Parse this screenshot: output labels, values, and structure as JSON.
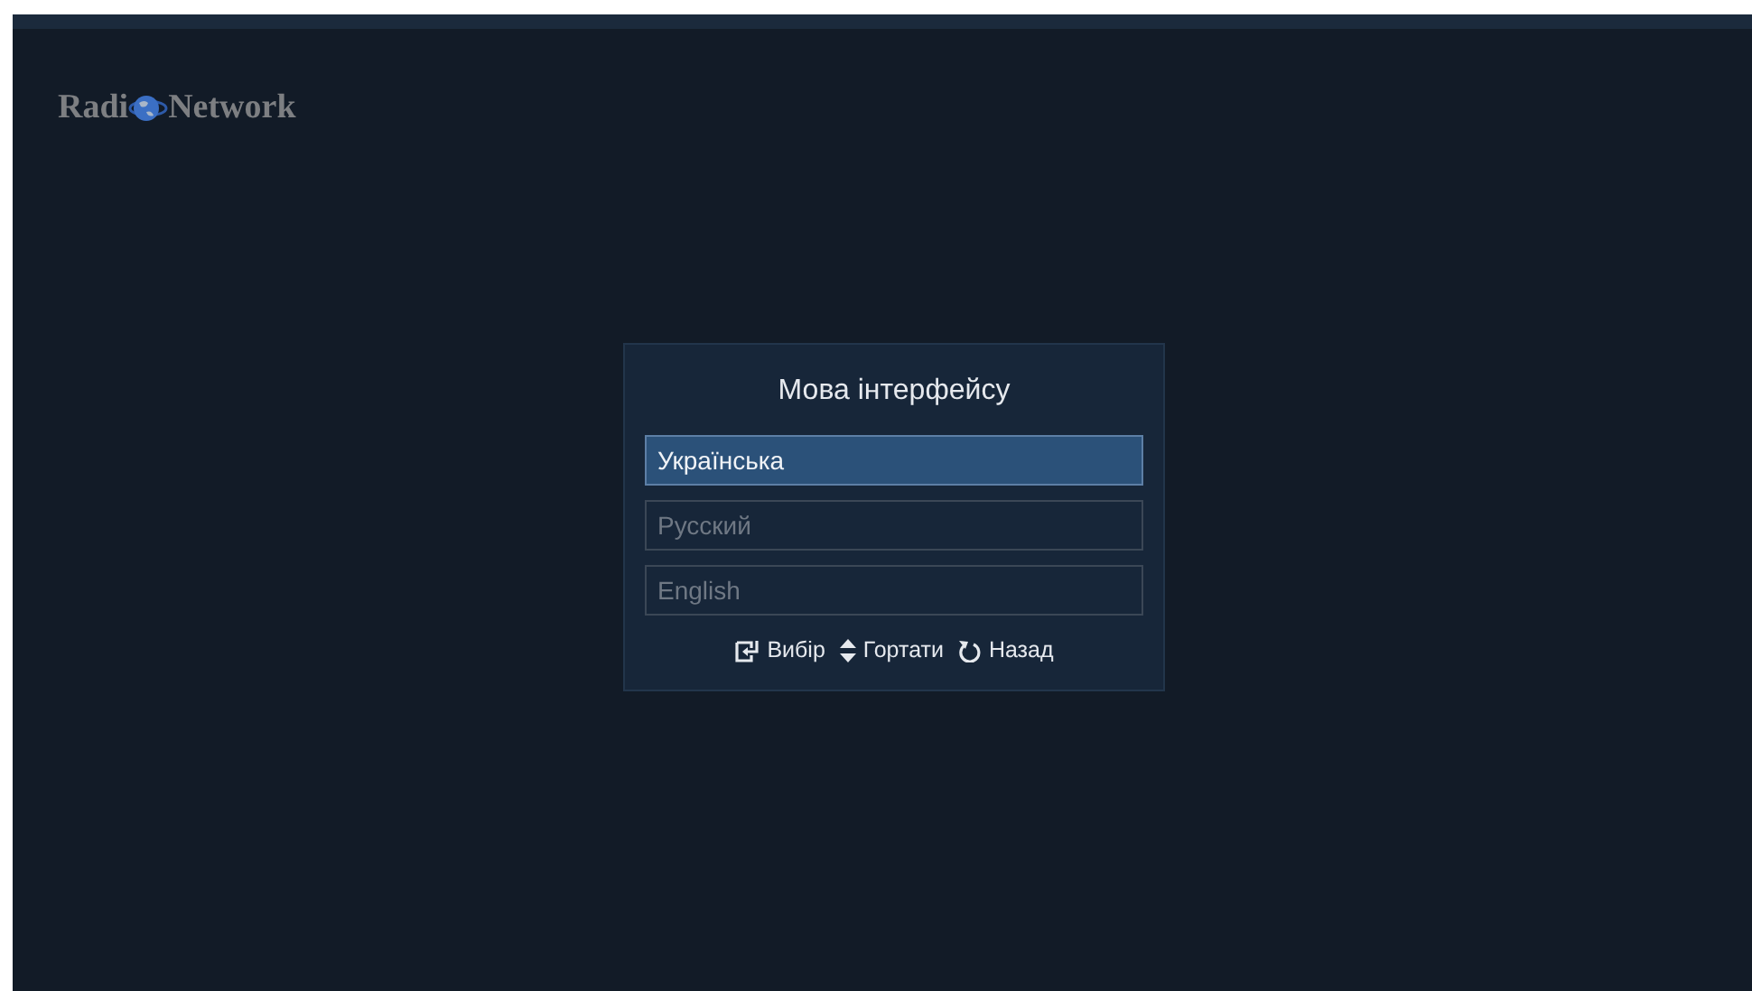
{
  "logo": {
    "text_before": "Radi",
    "text_after": "Network"
  },
  "dialog": {
    "title": "Мова інтерфейсу",
    "options": [
      {
        "label": "Українська",
        "selected": true
      },
      {
        "label": "Русский",
        "selected": false
      },
      {
        "label": "English",
        "selected": false
      }
    ],
    "hints": [
      {
        "kind": "enter",
        "label": "Вибір"
      },
      {
        "kind": "updown",
        "label": "Гортати"
      },
      {
        "kind": "back",
        "label": "Назад"
      }
    ]
  }
}
